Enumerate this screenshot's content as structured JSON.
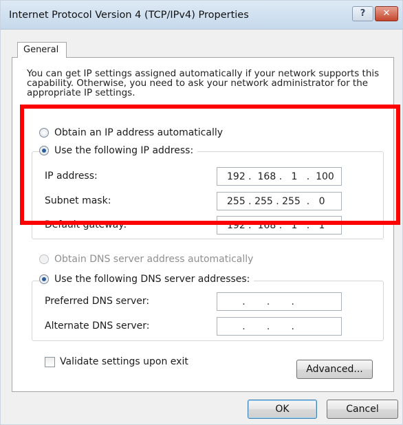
{
  "window": {
    "title": "Internet Protocol Version 4 (TCP/IPv4) Properties",
    "help_glyph": "?",
    "close_glyph": "✕"
  },
  "tabs": [
    {
      "label": "General"
    }
  ],
  "intro_text": "You can get IP settings assigned automatically if your network supports this capability. Otherwise, you need to ask your network administrator for the appropriate IP settings.",
  "ip_section": {
    "auto_option": {
      "label": "Obtain an IP address automatically",
      "selected": false
    },
    "manual_option": {
      "label": "Use the following IP address:",
      "selected": true
    },
    "fields": [
      {
        "label": "IP address:",
        "value": "192 .  168 .   1   .  100"
      },
      {
        "label": "Subnet mask:",
        "value": "255 . 255 . 255  .   0"
      },
      {
        "label": "Default gateway:",
        "value": "192 .  168 .   1   .   1"
      }
    ]
  },
  "dns_section": {
    "auto_option": {
      "label": "Obtain DNS server address automatically",
      "selected": false,
      "disabled": true
    },
    "manual_option": {
      "label": "Use the following DNS server addresses:",
      "selected": true
    },
    "fields": [
      {
        "label": "Preferred DNS server:",
        "value": "     .       .       ."
      },
      {
        "label": "Alternate DNS server:",
        "value": "     .       .       ."
      }
    ]
  },
  "validate_checkbox": {
    "label": "Validate settings upon exit",
    "checked": false
  },
  "buttons": {
    "advanced": "Advanced...",
    "ok": "OK",
    "cancel": "Cancel"
  },
  "colors": {
    "highlight": "#ff0000",
    "title_bar": "#c6d9ec",
    "close_button": "#c4452c"
  }
}
